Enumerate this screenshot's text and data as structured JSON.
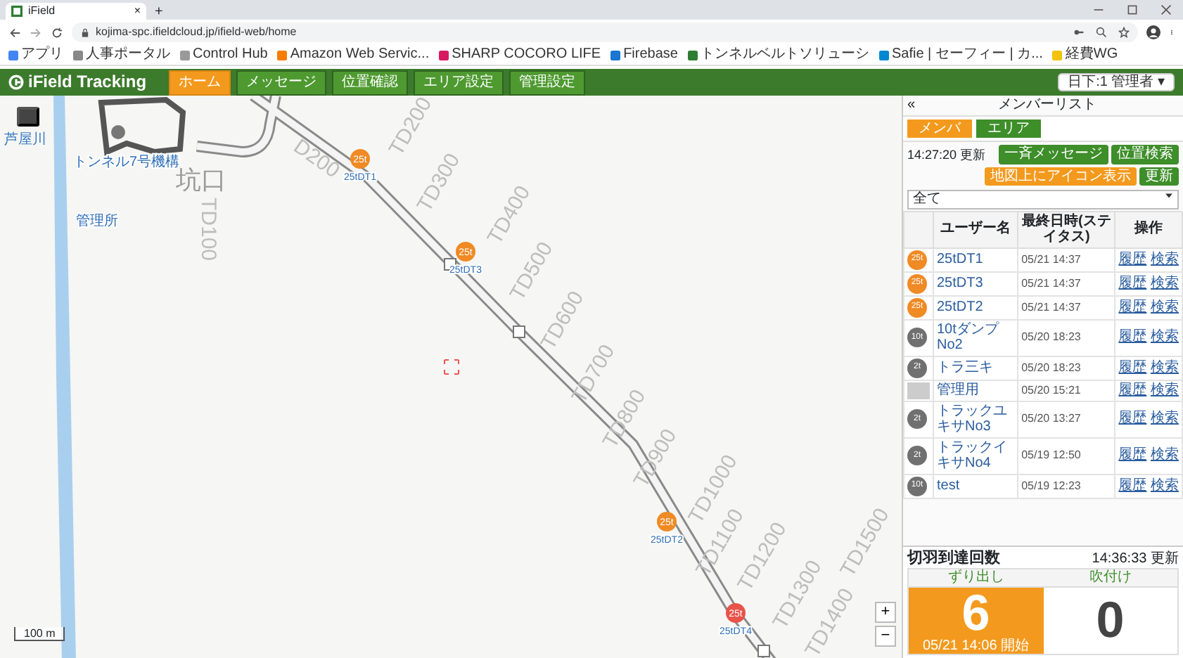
{
  "browser": {
    "tab_title": "iField",
    "tab_close": "×",
    "new_tab": "+",
    "url": "kojima-spc.ifieldcloud.jp/ifield-web/home",
    "bookmarks": [
      "アプリ",
      "人事ポータル",
      "Control Hub",
      "Amazon Web Servic...",
      "SHARP COCORO LIFE",
      "Firebase",
      "トンネルベルトソリューシ",
      "Safie | セーフィー | カ...",
      "経費WG"
    ]
  },
  "app": {
    "logo": "iField Tracking",
    "nav": [
      {
        "label": "ホーム",
        "selected": true
      },
      {
        "label": "メッセージ",
        "selected": false
      },
      {
        "label": "位置確認",
        "selected": false
      },
      {
        "label": "エリア設定",
        "selected": false
      },
      {
        "label": "管理設定",
        "selected": false
      }
    ],
    "user_menu": "日下:1 管理者 ▾"
  },
  "map": {
    "stations": [
      "TD100",
      "D200",
      "TD200",
      "TD300",
      "TD400",
      "TD500",
      "TD600",
      "TD700",
      "TD800",
      "TD900",
      "TD1000",
      "TD1100",
      "TD1200",
      "TD1300",
      "TD1400",
      "TD1500"
    ],
    "places": [
      {
        "label": "芦屋川",
        "kind": "water"
      },
      {
        "label": "トンネル7号機構",
        "kind": "facility"
      },
      {
        "label": "管理所",
        "kind": "facility"
      },
      {
        "label": "坑口",
        "kind": "area"
      }
    ],
    "markers": [
      {
        "text": "25t",
        "label": "25tDT1",
        "color": "#f08a24"
      },
      {
        "text": "25t",
        "label": "25tDT3",
        "color": "#f08a24"
      },
      {
        "text": "25t",
        "label": "25tDT2",
        "color": "#f08a24"
      },
      {
        "text": "25t",
        "label": "25tDT4",
        "color": "#e8534a"
      }
    ],
    "scale": "100 m",
    "zoom": [
      "+",
      "−"
    ]
  },
  "member_panel": {
    "title": "メンバーリスト",
    "collapse": "«",
    "tabs": [
      {
        "label": "メンバ",
        "selected": true
      },
      {
        "label": "エリア",
        "selected": false
      }
    ],
    "updated": "14:27:20 更新",
    "buttons": [
      {
        "label": "一斉メッセージ",
        "color": "#3e8e2a"
      },
      {
        "label": "位置検索",
        "color": "#3e8e2a"
      },
      {
        "label": "地図上にアイコン表示",
        "color": "#f39a1e"
      },
      {
        "label": "更新",
        "color": "#3e8e2a"
      }
    ],
    "filter": "全て",
    "columns": [
      "ユーザー名",
      "最終日時(ステイタス)",
      "操作"
    ],
    "rows": [
      {
        "avatar": {
          "kind": "circle",
          "text": "25t",
          "color": "#f08a24"
        },
        "name": "25tDT1",
        "time": "05/21 14:37",
        "actions": [
          "履歴",
          "検索"
        ]
      },
      {
        "avatar": {
          "kind": "circle",
          "text": "25t",
          "color": "#f08a24"
        },
        "name": "25tDT3",
        "time": "05/21 14:37",
        "actions": [
          "履歴",
          "検索"
        ]
      },
      {
        "avatar": {
          "kind": "circle",
          "text": "25t",
          "color": "#f08a24"
        },
        "name": "25tDT2",
        "time": "05/21 14:37",
        "actions": [
          "履歴",
          "検索"
        ]
      },
      {
        "avatar": {
          "kind": "circle",
          "text": "10t",
          "color": "#707070"
        },
        "name": "10tダンプNo2",
        "time": "05/20 18:23",
        "actions": [
          "履歴",
          "検索"
        ]
      },
      {
        "avatar": {
          "kind": "circle",
          "text": "2t",
          "color": "#707070"
        },
        "name": "トラ三キ",
        "time": "05/20 18:23",
        "actions": [
          "履歴",
          "検索"
        ]
      },
      {
        "avatar": {
          "kind": "photo"
        },
        "name": "管理用",
        "time": "05/20 15:21",
        "actions": [
          "履歴",
          "検索"
        ]
      },
      {
        "avatar": {
          "kind": "circle",
          "text": "2t",
          "color": "#707070"
        },
        "name": "トラックユキサNo3",
        "time": "05/20 13:27",
        "actions": [
          "履歴",
          "検索"
        ]
      },
      {
        "avatar": {
          "kind": "circle",
          "text": "2t",
          "color": "#707070"
        },
        "name": "トラックイキサNo4",
        "time": "05/19 12:50",
        "actions": [
          "履歴",
          "検索"
        ]
      },
      {
        "avatar": {
          "kind": "circle",
          "text": "10t",
          "color": "#707070"
        },
        "name": "test",
        "time": "05/19 12:23",
        "actions": [
          "履歴",
          "検索"
        ]
      }
    ]
  },
  "arrival": {
    "title": "切羽到達回数",
    "updated": "14:36:33 更新",
    "counters": [
      {
        "label": "ずり出し",
        "value": "6",
        "note": "05/21 14:06 開始",
        "active": true
      },
      {
        "label": "吹付け",
        "value": "0",
        "active": false
      }
    ]
  }
}
